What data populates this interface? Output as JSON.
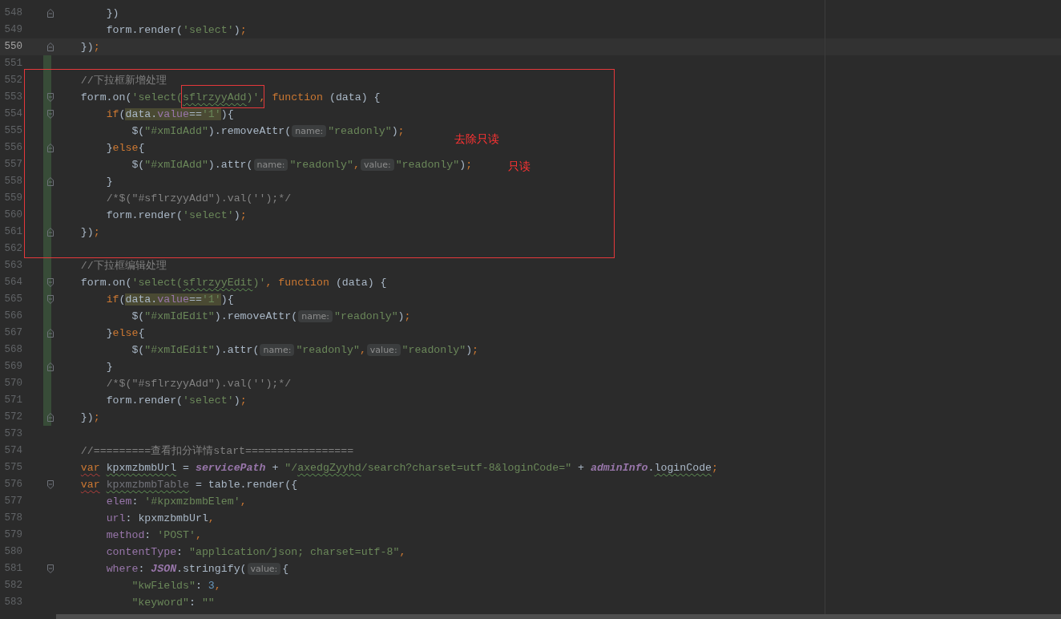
{
  "editor": {
    "lines": [
      {
        "number": "548",
        "current": false,
        "changed": false,
        "fold_start": false,
        "fold_end": true,
        "code": [
          {
            "kind": "plain",
            "text": "        })"
          }
        ]
      },
      {
        "number": "549",
        "current": false,
        "changed": false,
        "fold_start": false,
        "fold_end": false,
        "code": [
          {
            "kind": "plain",
            "text": "        form.render("
          },
          {
            "kind": "string",
            "text": "'select'"
          },
          {
            "kind": "plain",
            "text": ")"
          },
          {
            "kind": "keyword",
            "text": ";"
          }
        ]
      },
      {
        "number": "550",
        "current": true,
        "changed": false,
        "fold_start": false,
        "fold_end": true,
        "code": [
          {
            "kind": "plain",
            "text": "    })"
          },
          {
            "kind": "keyword",
            "text": ";"
          }
        ]
      },
      {
        "number": "551",
        "current": false,
        "changed": true,
        "fold_start": false,
        "fold_end": false
      },
      {
        "number": "552",
        "current": false,
        "changed": true,
        "fold_start": false,
        "fold_end": false,
        "code": [
          {
            "kind": "comment",
            "text": "    //下拉框新增处理"
          }
        ]
      },
      {
        "number": "553",
        "current": false,
        "changed": true,
        "fold_start": true,
        "fold_end": false,
        "code": [
          {
            "kind": "plain",
            "text": "    form.on("
          },
          {
            "kind": "string",
            "text": "'select("
          },
          {
            "kind": "string",
            "text": "sflrzyyAdd",
            "typo": true
          },
          {
            "kind": "string",
            "text": ")'"
          },
          {
            "kind": "keyword",
            "text": ", function"
          },
          {
            "kind": "plain",
            "text": " (data) {"
          }
        ]
      },
      {
        "number": "554",
        "current": false,
        "changed": true,
        "fold_start": true,
        "fold_end": false,
        "code": [
          {
            "kind": "keyword",
            "text": "        if"
          },
          {
            "kind": "plain",
            "text": "("
          },
          {
            "kind": "plain",
            "text": "data.",
            "match": true
          },
          {
            "kind": "property",
            "text": "value",
            "match": true
          },
          {
            "kind": "plain",
            "text": "==",
            "match": true
          },
          {
            "kind": "string",
            "text": "'1'",
            "match": true
          },
          {
            "kind": "plain",
            "text": "){"
          }
        ]
      },
      {
        "number": "555",
        "current": false,
        "changed": true,
        "fold_start": false,
        "fold_end": false,
        "code": [
          {
            "kind": "plain",
            "text": "            $("
          },
          {
            "kind": "string",
            "text": "\"#xmIdAdd\""
          },
          {
            "kind": "plain",
            "text": ").removeAttr("
          },
          {
            "kind": "hint",
            "text": "name:"
          },
          {
            "kind": "string",
            "text": "\"readonly\""
          },
          {
            "kind": "plain",
            "text": ")"
          },
          {
            "kind": "keyword",
            "text": ";"
          }
        ]
      },
      {
        "number": "556",
        "current": false,
        "changed": true,
        "fold_start": false,
        "fold_end": true,
        "code": [
          {
            "kind": "plain",
            "text": "        }"
          },
          {
            "kind": "keyword",
            "text": "else"
          },
          {
            "kind": "plain",
            "text": "{"
          }
        ]
      },
      {
        "number": "557",
        "current": false,
        "changed": true,
        "fold_start": false,
        "fold_end": false,
        "code": [
          {
            "kind": "plain",
            "text": "            $("
          },
          {
            "kind": "string",
            "text": "\"#xmIdAdd\""
          },
          {
            "kind": "plain",
            "text": ").attr("
          },
          {
            "kind": "hint",
            "text": "name:"
          },
          {
            "kind": "string",
            "text": "\"readonly\""
          },
          {
            "kind": "keyword",
            "text": ","
          },
          {
            "kind": "hint",
            "text": "value:"
          },
          {
            "kind": "string",
            "text": "\"readonly\""
          },
          {
            "kind": "plain",
            "text": ")"
          },
          {
            "kind": "keyword",
            "text": ";"
          }
        ]
      },
      {
        "number": "558",
        "current": false,
        "changed": true,
        "fold_start": false,
        "fold_end": true,
        "code": [
          {
            "kind": "plain",
            "text": "        }"
          }
        ]
      },
      {
        "number": "559",
        "current": false,
        "changed": true,
        "fold_start": false,
        "fold_end": false,
        "code": [
          {
            "kind": "comment",
            "text": "        /*$(\"#sflrzyyAdd\").val('');*/"
          }
        ]
      },
      {
        "number": "560",
        "current": false,
        "changed": true,
        "fold_start": false,
        "fold_end": false,
        "code": [
          {
            "kind": "plain",
            "text": "        form.render("
          },
          {
            "kind": "string",
            "text": "'select'"
          },
          {
            "kind": "plain",
            "text": ")"
          },
          {
            "kind": "keyword",
            "text": ";"
          }
        ]
      },
      {
        "number": "561",
        "current": false,
        "changed": true,
        "fold_start": false,
        "fold_end": true,
        "code": [
          {
            "kind": "plain",
            "text": "    })"
          },
          {
            "kind": "keyword",
            "text": ";"
          }
        ]
      },
      {
        "number": "562",
        "current": false,
        "changed": true,
        "fold_start": false,
        "fold_end": false
      },
      {
        "number": "563",
        "current": false,
        "changed": true,
        "fold_start": false,
        "fold_end": false,
        "code": [
          {
            "kind": "comment",
            "text": "    //下拉框编辑处理"
          }
        ]
      },
      {
        "number": "564",
        "current": false,
        "changed": true,
        "fold_start": true,
        "fold_end": false,
        "code": [
          {
            "kind": "plain",
            "text": "    form.on("
          },
          {
            "kind": "string",
            "text": "'select("
          },
          {
            "kind": "string",
            "text": "sflrzyyEdit",
            "typo": true
          },
          {
            "kind": "string",
            "text": ")'"
          },
          {
            "kind": "keyword",
            "text": ", function"
          },
          {
            "kind": "plain",
            "text": " (data) {"
          }
        ]
      },
      {
        "number": "565",
        "current": false,
        "changed": true,
        "fold_start": true,
        "fold_end": false,
        "code": [
          {
            "kind": "keyword",
            "text": "        if"
          },
          {
            "kind": "plain",
            "text": "("
          },
          {
            "kind": "plain",
            "text": "data.",
            "match": true
          },
          {
            "kind": "property",
            "text": "value",
            "match": true
          },
          {
            "kind": "plain",
            "text": "==",
            "match": true
          },
          {
            "kind": "string",
            "text": "'1'",
            "match": true
          },
          {
            "kind": "plain",
            "text": "){"
          }
        ]
      },
      {
        "number": "566",
        "current": false,
        "changed": true,
        "fold_start": false,
        "fold_end": false,
        "code": [
          {
            "kind": "plain",
            "text": "            $("
          },
          {
            "kind": "string",
            "text": "\"#xmIdEdit\""
          },
          {
            "kind": "plain",
            "text": ").removeAttr("
          },
          {
            "kind": "hint",
            "text": "name:"
          },
          {
            "kind": "string",
            "text": "\"readonly\""
          },
          {
            "kind": "plain",
            "text": ")"
          },
          {
            "kind": "keyword",
            "text": ";"
          }
        ]
      },
      {
        "number": "567",
        "current": false,
        "changed": true,
        "fold_start": false,
        "fold_end": true,
        "code": [
          {
            "kind": "plain",
            "text": "        }"
          },
          {
            "kind": "keyword",
            "text": "else"
          },
          {
            "kind": "plain",
            "text": "{"
          }
        ]
      },
      {
        "number": "568",
        "current": false,
        "changed": true,
        "fold_start": false,
        "fold_end": false,
        "code": [
          {
            "kind": "plain",
            "text": "            $("
          },
          {
            "kind": "string",
            "text": "\"#xmIdEdit\""
          },
          {
            "kind": "plain",
            "text": ").attr("
          },
          {
            "kind": "hint",
            "text": "name:"
          },
          {
            "kind": "string",
            "text": "\"readonly\""
          },
          {
            "kind": "keyword",
            "text": ","
          },
          {
            "kind": "hint",
            "text": "value:"
          },
          {
            "kind": "string",
            "text": "\"readonly\""
          },
          {
            "kind": "plain",
            "text": ")"
          },
          {
            "kind": "keyword",
            "text": ";"
          }
        ]
      },
      {
        "number": "569",
        "current": false,
        "changed": true,
        "fold_start": false,
        "fold_end": true,
        "code": [
          {
            "kind": "plain",
            "text": "        }"
          }
        ]
      },
      {
        "number": "570",
        "current": false,
        "changed": true,
        "fold_start": false,
        "fold_end": false,
        "code": [
          {
            "kind": "comment",
            "text": "        /*$(\"#sflrzyyAdd\").val('');*/"
          }
        ]
      },
      {
        "number": "571",
        "current": false,
        "changed": true,
        "fold_start": false,
        "fold_end": false,
        "code": [
          {
            "kind": "plain",
            "text": "        form.render("
          },
          {
            "kind": "string",
            "text": "'select'"
          },
          {
            "kind": "plain",
            "text": ")"
          },
          {
            "kind": "keyword",
            "text": ";"
          }
        ]
      },
      {
        "number": "572",
        "current": false,
        "changed": true,
        "fold_start": false,
        "fold_end": true,
        "code": [
          {
            "kind": "plain",
            "text": "    })"
          },
          {
            "kind": "keyword",
            "text": ";"
          }
        ]
      },
      {
        "number": "573",
        "current": false,
        "changed": false,
        "fold_start": false,
        "fold_end": false
      },
      {
        "number": "574",
        "current": false,
        "changed": false,
        "fold_start": false,
        "fold_end": false,
        "code": [
          {
            "kind": "comment",
            "text": "    //=========查看扣分详情start================="
          }
        ]
      },
      {
        "number": "575",
        "current": false,
        "changed": false,
        "fold_start": false,
        "fold_end": false,
        "code": [
          {
            "kind": "keyword",
            "text": "    var",
            "typo": true
          },
          {
            "kind": "plain",
            "text": " kpxmzbmbUrl",
            "typo": true
          },
          {
            "kind": "plain",
            "text": " = "
          },
          {
            "kind": "global",
            "text": "servicePath"
          },
          {
            "kind": "plain",
            "text": " + "
          },
          {
            "kind": "string",
            "text": "\"/"
          },
          {
            "kind": "string",
            "text": "axedgZyyhd",
            "typo": true
          },
          {
            "kind": "string",
            "text": "/search?charset=utf-8&loginCode=\""
          },
          {
            "kind": "plain",
            "text": " + "
          },
          {
            "kind": "global",
            "text": "adminInfo"
          },
          {
            "kind": "plain",
            "text": "."
          },
          {
            "kind": "plain",
            "text": "loginCode",
            "typo": true
          },
          {
            "kind": "keyword",
            "text": ";"
          }
        ]
      },
      {
        "number": "576",
        "current": false,
        "changed": false,
        "fold_start": true,
        "fold_end": false,
        "code": [
          {
            "kind": "keyword",
            "text": "    var",
            "typo": true
          },
          {
            "kind": "unused",
            "text": " kpxmzbmbTable",
            "typo": true
          },
          {
            "kind": "plain",
            "text": " = table.render({"
          }
        ]
      },
      {
        "number": "577",
        "current": false,
        "changed": false,
        "fold_start": false,
        "fold_end": false,
        "code": [
          {
            "kind": "property",
            "text": "        elem"
          },
          {
            "kind": "plain",
            "text": ": "
          },
          {
            "kind": "string",
            "text": "'#kpxmzbmbElem'"
          },
          {
            "kind": "keyword",
            "text": ","
          }
        ]
      },
      {
        "number": "578",
        "current": false,
        "changed": false,
        "fold_start": false,
        "fold_end": false,
        "code": [
          {
            "kind": "property",
            "text": "        url"
          },
          {
            "kind": "plain",
            "text": ": kpxmzbmbUrl"
          },
          {
            "kind": "keyword",
            "text": ","
          }
        ]
      },
      {
        "number": "579",
        "current": false,
        "changed": false,
        "fold_start": false,
        "fold_end": false,
        "code": [
          {
            "kind": "property",
            "text": "        method"
          },
          {
            "kind": "plain",
            "text": ": "
          },
          {
            "kind": "string",
            "text": "'POST'"
          },
          {
            "kind": "keyword",
            "text": ","
          }
        ]
      },
      {
        "number": "580",
        "current": false,
        "changed": false,
        "fold_start": false,
        "fold_end": false,
        "code": [
          {
            "kind": "property",
            "text": "        contentType"
          },
          {
            "kind": "plain",
            "text": ": "
          },
          {
            "kind": "string",
            "text": "\"application/json; charset=utf-8\""
          },
          {
            "kind": "keyword",
            "text": ","
          }
        ]
      },
      {
        "number": "581",
        "current": false,
        "changed": false,
        "fold_start": true,
        "fold_end": false,
        "code": [
          {
            "kind": "property",
            "text": "        where"
          },
          {
            "kind": "plain",
            "text": ": "
          },
          {
            "kind": "global",
            "text": "JSON"
          },
          {
            "kind": "plain",
            "text": ".stringify("
          },
          {
            "kind": "hint",
            "text": "value:"
          },
          {
            "kind": "plain",
            "text": "{"
          }
        ]
      },
      {
        "number": "582",
        "current": false,
        "changed": false,
        "fold_start": false,
        "fold_end": false,
        "code": [
          {
            "kind": "string",
            "text": "            \"kwFields\""
          },
          {
            "kind": "plain",
            "text": ": "
          },
          {
            "kind": "number",
            "text": "3"
          },
          {
            "kind": "keyword",
            "text": ","
          }
        ]
      },
      {
        "number": "583",
        "current": false,
        "changed": false,
        "fold_start": false,
        "fold_end": false,
        "code": [
          {
            "kind": "string",
            "text": "            \"keyword\""
          },
          {
            "kind": "plain",
            "text": ": "
          },
          {
            "kind": "string",
            "text": "\"\""
          }
        ]
      }
    ]
  },
  "annotations": [
    {
      "text": "去除只读"
    },
    {
      "text": "只读"
    }
  ]
}
